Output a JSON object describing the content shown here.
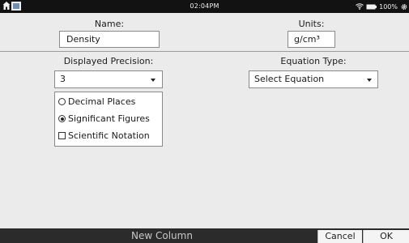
{
  "status_bar": {
    "time": "02:04PM",
    "battery": "100%",
    "icons": [
      "home-icon",
      "screenshot-icon",
      "wifi-icon",
      "battery-icon",
      "gear-icon"
    ]
  },
  "name": {
    "label": "Name:",
    "value": "Density"
  },
  "units": {
    "label": "Units:",
    "value": "g/cm³"
  },
  "precision": {
    "label": "Displayed Precision:",
    "value": "3",
    "options": [
      {
        "label": "Decimal Places",
        "kind": "radio",
        "checked": false
      },
      {
        "label": "Significant Figures",
        "kind": "radio",
        "checked": true
      },
      {
        "label": "Scientific Notation",
        "kind": "checkbox",
        "checked": false
      }
    ]
  },
  "equation": {
    "label": "Equation Type:",
    "value": "Select Equation"
  },
  "footer": {
    "title": "New Column",
    "cancel": "Cancel",
    "ok": "OK"
  }
}
